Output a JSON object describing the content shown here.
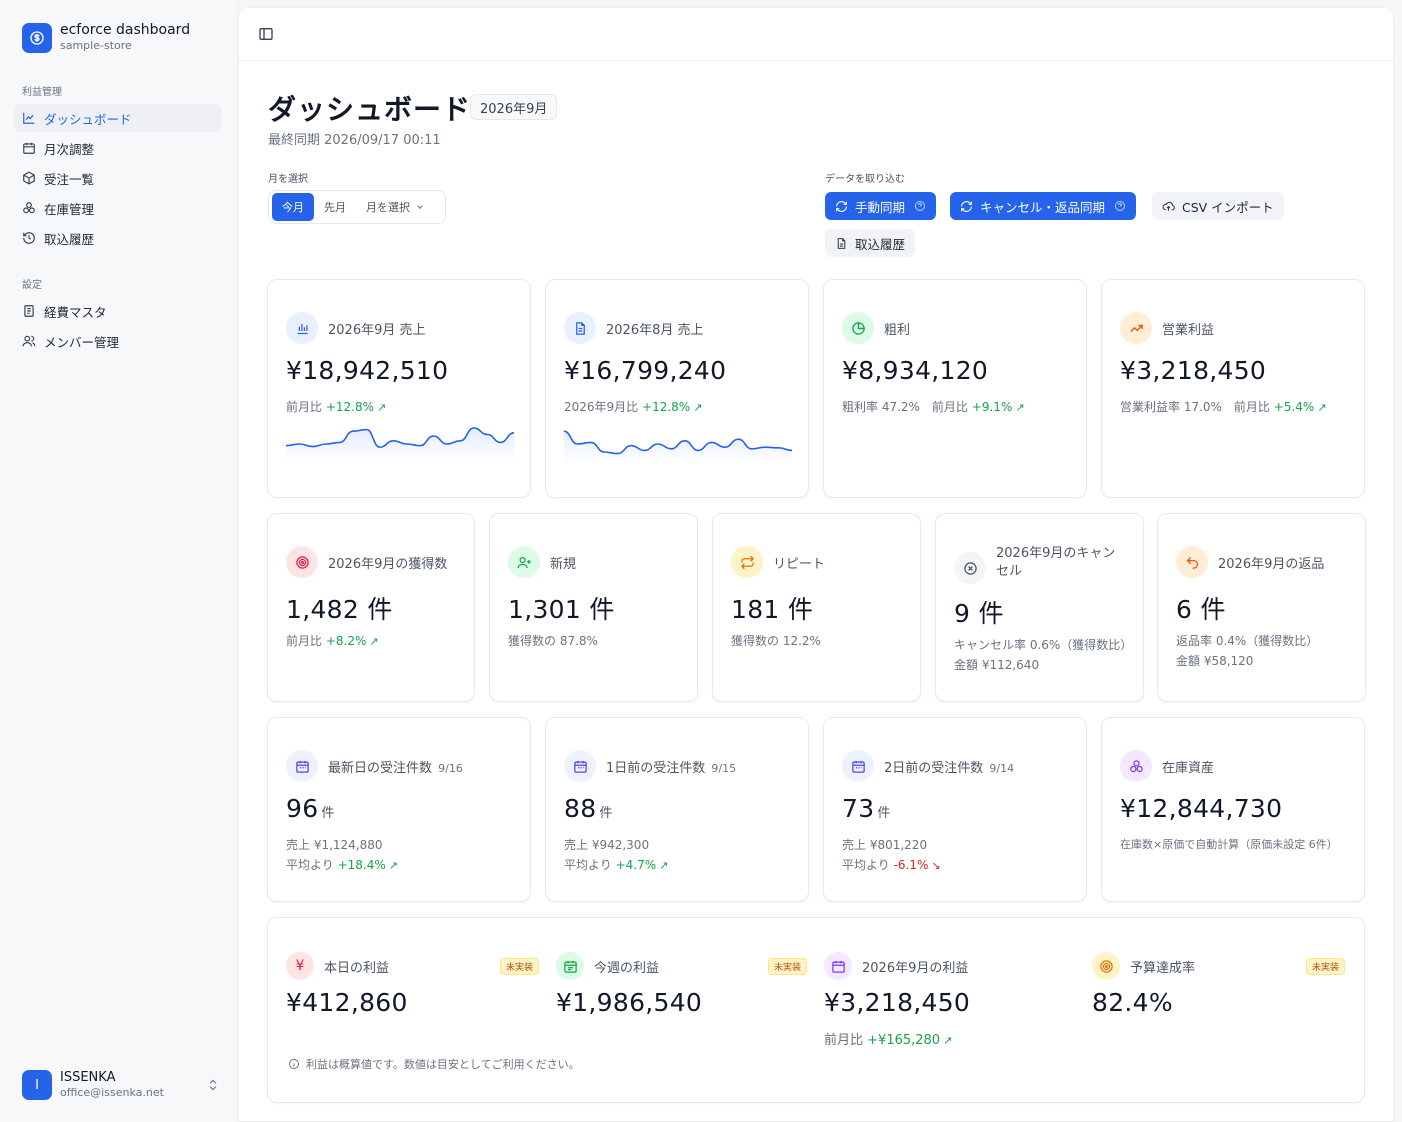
{
  "brand": {
    "title": "ecforce dashboard",
    "subtitle": "sample-store"
  },
  "sidebar": {
    "section_profit": "利益管理",
    "section_settings": "設定",
    "items": [
      {
        "label": "ダッシュボード",
        "icon": "line-chart-icon"
      },
      {
        "label": "月次調整",
        "icon": "calendar-icon"
      },
      {
        "label": "受注一覧",
        "icon": "box-icon"
      },
      {
        "label": "在庫管理",
        "icon": "boxes-icon"
      },
      {
        "label": "取込履歴",
        "icon": "history-icon"
      }
    ],
    "settings_items": [
      {
        "label": "経費マスタ",
        "icon": "receipt-icon"
      },
      {
        "label": "メンバー管理",
        "icon": "users-icon"
      }
    ]
  },
  "user": {
    "initial": "I",
    "name": "ISSENKA",
    "email": "office@issenka.net"
  },
  "header": {
    "title": "ダッシュボード",
    "month_badge": "2026年9月",
    "last_sync": "最終同期 2026/09/17 00:11"
  },
  "month_select": {
    "label": "月を選択",
    "options": [
      "今月",
      "先月",
      "月を選択"
    ],
    "selected": "今月"
  },
  "import": {
    "label": "データを取り込む",
    "manual_sync": "手動同期",
    "cancel_sync": "キャンセル・返品同期",
    "csv_import": "CSV インポート",
    "history": "取込履歴"
  },
  "row1": [
    {
      "label": "2026年9月 売上",
      "value": "¥18,942,510",
      "meta_prefix": "前月比",
      "meta_change": "+12.8%",
      "trend": "up",
      "spark": [
        0.45,
        0.5,
        0.42,
        0.5,
        0.55,
        0.9,
        0.95,
        0.4,
        0.6,
        0.5,
        0.45,
        0.75,
        0.5,
        0.6,
        1.0,
        0.8,
        0.55,
        0.85
      ]
    },
    {
      "label": "2026年8月 売上",
      "value": "¥16,799,240",
      "meta_prefix": "2026年9月比",
      "meta_change": "+12.8%",
      "trend": "up",
      "spark": [
        0.9,
        0.5,
        0.55,
        0.25,
        0.2,
        0.45,
        0.3,
        0.5,
        0.35,
        0.6,
        0.3,
        0.55,
        0.4,
        0.65,
        0.35,
        0.4,
        0.38,
        0.3
      ]
    },
    {
      "label": "粗利",
      "value": "¥8,934,120",
      "meta_prefix": "粗利率 47.2%　前月比",
      "meta_change": "+9.1%",
      "trend": "up"
    },
    {
      "label": "営業利益",
      "value": "¥3,218,450",
      "meta_prefix": "営業利益率 17.0%　前月比",
      "meta_change": "+5.4%",
      "trend": "up"
    }
  ],
  "row2": [
    {
      "label": "2026年9月の獲得数",
      "value": "1,482 件",
      "meta1_prefix": "前月比",
      "meta1_change": "+8.2%",
      "trend": "up"
    },
    {
      "label": "新規",
      "value": "1,301 件",
      "meta1": "獲得数の 87.8%"
    },
    {
      "label": "リピート",
      "value": "181 件",
      "meta1": "獲得数の 12.2%"
    },
    {
      "label_line1": "2026年9月のキャン",
      "label_line2": "セル",
      "value": "9 件",
      "meta1": "キャンセル率 0.6%（獲得数比）",
      "meta2": "金額 ¥112,640"
    },
    {
      "label": "2026年9月の返品",
      "value": "6 件",
      "meta1": "返品率 0.4%（獲得数比）",
      "meta2": "金額 ¥58,120"
    }
  ],
  "row3": [
    {
      "label": "最新日の受注件数",
      "date": "9/16",
      "value": "96",
      "unit": "件",
      "sales": "売上 ¥1,124,880",
      "avg_prefix": "平均より",
      "avg_change": "+18.4%",
      "trend": "up"
    },
    {
      "label": "1日前の受注件数",
      "date": "9/15",
      "value": "88",
      "unit": "件",
      "sales": "売上 ¥942,300",
      "avg_prefix": "平均より",
      "avg_change": "+4.7%",
      "trend": "up"
    },
    {
      "label": "2日前の受注件数",
      "date": "9/14",
      "value": "73",
      "unit": "件",
      "sales": "売上 ¥801,220",
      "avg_prefix": "平均より",
      "avg_change": "-6.1%",
      "trend": "down"
    },
    {
      "label": "在庫資産",
      "value": "¥12,844,730",
      "meta1": "在庫数×原価で自動計算（原価未設定 6件）"
    }
  ],
  "profit": {
    "items": [
      {
        "label": "本日の利益",
        "value": "¥412,860",
        "badge": "未実装"
      },
      {
        "label": "今週の利益",
        "value": "¥1,986,540",
        "badge": "未実装"
      },
      {
        "label": "2026年9月の利益",
        "value": "¥3,218,450",
        "meta_prefix": "前月比",
        "meta_change": "+¥165,280",
        "trend": "up"
      },
      {
        "label": "予算達成率",
        "value": "82.4%",
        "badge": "未実装"
      }
    ],
    "note": "利益は概算値です。数値は目安としてご利用ください。"
  },
  "colors": {
    "accent": "#2563eb",
    "up": "#16a34a",
    "down": "#dc2626",
    "spark": "#2563eb"
  }
}
